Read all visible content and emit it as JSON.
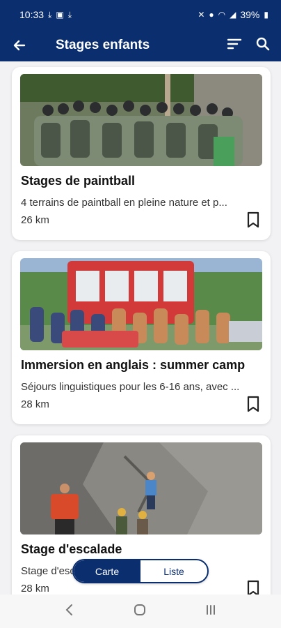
{
  "status": {
    "time": "10:33",
    "battery": "39%"
  },
  "header": {
    "title": "Stages enfants"
  },
  "cards": [
    {
      "title": "Stages de paintball",
      "description": "4 terrains de paintball en pleine nature et p...",
      "distance": "26 km",
      "image": "paintball-group-photo"
    },
    {
      "title": "Immersion en anglais : summer camp",
      "description": "Séjours linguistiques pour les 6-16 ans, avec ...",
      "distance": "28 km",
      "image": "summer-camp-group-photo"
    },
    {
      "title": "Stage d'escalade",
      "description": "Stage d'escalade ... lundi au...",
      "distance": "28 km",
      "image": "climbing-wall-photo"
    }
  ],
  "view_toggle": {
    "map_label": "Carte",
    "list_label": "Liste"
  },
  "colors": {
    "primary": "#0b2e6e",
    "background": "#f2f2f4"
  }
}
